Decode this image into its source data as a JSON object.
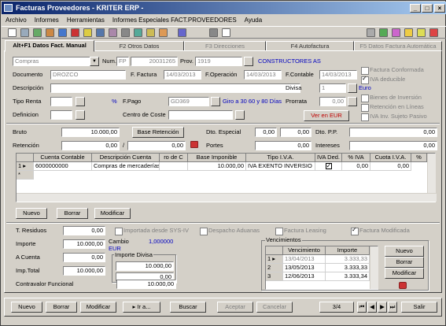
{
  "window": {
    "title": "Facturas Proveedores - KRITER ERP -",
    "min": "_",
    "max": "□",
    "close": "×"
  },
  "menu": [
    "Archivo",
    "Informes",
    "Herramientas",
    "Informes Especiales FACT.PROVEEDORES",
    "Ayuda"
  ],
  "tabs": [
    {
      "label": "Alt+F1 Datos Fact. Manual",
      "active": true
    },
    {
      "label": "F2 Otros Datos"
    },
    {
      "label": "F3 Direcciones",
      "disabled": true
    },
    {
      "label": "F4 Autofactura"
    },
    {
      "label": "F5 Datos Factura Automática",
      "disabled": true
    }
  ],
  "header": {
    "tipo": "Compras",
    "num_label": "Num.",
    "num_prefix": "FP",
    "num_value": "20031265",
    "prov_label": "Prov.",
    "prov_code": "1919",
    "prov_name": "CONSTRUCTORES AS",
    "doc_label": "Documento",
    "doc_value": "DROZCO",
    "factura_label": "F. Factura",
    "factura_value": "14/03/2013",
    "operacion_label": "F.Operación",
    "operacion_value": "14/03/2013",
    "contable_label": "F.Contable",
    "contable_value": "14/03/2013",
    "desc_label": "Descripción",
    "divisa_label": "Divisa",
    "divisa_value": "1",
    "divisa_name": "Euro",
    "renta_label": "Tipo Renta",
    "pct": "%",
    "fpago_label": "F.Pago",
    "fpago_code": "GD369",
    "fpago_text": "Giro a 30 60 y 80 Días",
    "prorrata_label": "Prorrata",
    "prorrata_value": "0,00",
    "def_label": "Definicion",
    "centro_label": "Centro de Coste",
    "ver_eur": "Ver en EUR"
  },
  "checks": [
    {
      "label": "Factura Conformada",
      "on": false
    },
    {
      "label": "IVA deducible",
      "on": true
    },
    {
      "label": "Bienes de Inversión",
      "on": false
    },
    {
      "label": "Retención en Líneas",
      "on": false
    },
    {
      "label": "IVA Inv. Sujeto Pasivo",
      "on": false
    }
  ],
  "totals": {
    "bruto_label": "Bruto",
    "bruto": "10.000,00",
    "base_ret_btn": "Base Retención",
    "ret_label": "Retención",
    "ret_pct": "0,00",
    "ret_amt": "0,00",
    "dto_esp_label": "Dto. Especial",
    "dto_esp_pct": "0,00",
    "dto_esp_amt": "0,00",
    "dto_pp_label": "Dto. P.P.",
    "dto_pp_pct": "0,00",
    "portes_label": "Portes",
    "portes": "0,00",
    "intereses_label": "Intereses",
    "intereses": "0,00"
  },
  "lines": {
    "columns": [
      "Cuenta Contable",
      "Descripción Cuenta",
      "ro de C",
      "Base Imponible",
      "Tipo I.V.A.",
      "IVA Ded.",
      "% IVA",
      "Cuota I.V.A.",
      "%"
    ],
    "rows": [
      {
        "num": "1",
        "cuenta": "6000000000",
        "desc": "Compras de mercaderías",
        "roc": "",
        "base": "10.000,00",
        "tipo": "IVA EXENTO INVERSIO",
        "ded": true,
        "pct": "0,00",
        "cuota": "0,00"
      }
    ],
    "new_row_marker": "*"
  },
  "line_buttons": {
    "nuevo": "Nuevo",
    "borrar": "Borrar",
    "modificar": "Modificar"
  },
  "lower": {
    "residuos_label": "T. Residuos",
    "residuos": "0,00",
    "importe_label": "Importe",
    "importe": "10.000,00",
    "cuenta_label": "A Cuenta",
    "cuenta": "0,00",
    "imptotal_label": "Imp.Total",
    "imptotal": "10.000,00",
    "contravalor_label": "Contravalor Funcional",
    "contravalor": "10.000,00",
    "cambio_label": "Cambio",
    "cambio_value": "1,000000",
    "cambio_cur": "EUR",
    "importe_divisa_label": "Importe Divisa",
    "importe_divisa": "10.000,00",
    "importe_divisa2": "0,00"
  },
  "lower_checks": [
    {
      "label": "Importada desde SYS-IV",
      "on": false
    },
    {
      "label": "Despacho Aduanas",
      "on": false
    },
    {
      "label": "Factura Leasing",
      "on": false
    },
    {
      "label": "Factura Modificada",
      "on": true
    }
  ],
  "vencimientos": {
    "title": "Vencimientos",
    "columns": [
      "Vencimiento",
      "Importe"
    ],
    "rows": [
      {
        "n": "1",
        "fecha": "13/04/2013",
        "importe": "3.333,33"
      },
      {
        "n": "2",
        "fecha": "13/05/2013",
        "importe": "3.333,33"
      },
      {
        "n": "3",
        "fecha": "12/06/2013",
        "importe": "3.333,34"
      }
    ],
    "nuevo": "Nuevo",
    "borrar": "Borrar",
    "modificar": "Modificar"
  },
  "footer": {
    "nuevo": "Nuevo",
    "borrar": "Borrar",
    "modificar": "Modificar",
    "ir": "Ir a...",
    "buscar": "Buscar",
    "aceptar": "Aceptar",
    "cancelar": "Cancelar",
    "page": "3/4",
    "salir": "Salir"
  }
}
